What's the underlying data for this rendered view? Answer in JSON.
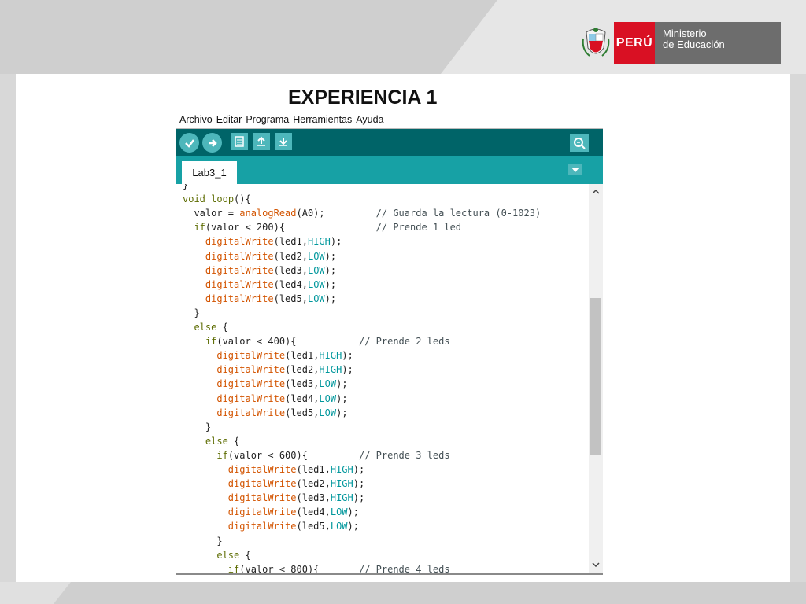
{
  "slide": {
    "title": "EXPERIENCIA 1",
    "brand": {
      "country": "PERÚ",
      "ministry_line1": "Ministerio",
      "ministry_line2": "de Educación"
    }
  },
  "ide": {
    "menu": [
      "Archivo",
      "Editar",
      "Programa",
      "Herramientas",
      "Ayuda"
    ],
    "toolbar": [
      "verify-icon",
      "upload-icon",
      "new-icon",
      "open-icon",
      "save-icon",
      "serial-monitor-icon"
    ],
    "tab_label": "Lab3_1",
    "code_lines": [
      [
        {
          "t": "}",
          "c": ""
        }
      ],
      [
        {
          "t": "void",
          "c": "kw"
        },
        {
          "t": " ",
          "c": ""
        },
        {
          "t": "loop",
          "c": "kw"
        },
        {
          "t": "(){",
          "c": ""
        }
      ],
      [
        {
          "t": "  valor = ",
          "c": ""
        },
        {
          "t": "analogRead",
          "c": "fn"
        },
        {
          "t": "(A0);         ",
          "c": ""
        },
        {
          "t": "// Guarda la lectura (0-1023)",
          "c": "cm"
        }
      ],
      [
        {
          "t": "  ",
          "c": ""
        },
        {
          "t": "if",
          "c": "kw"
        },
        {
          "t": "(valor < 200){                ",
          "c": ""
        },
        {
          "t": "// Prende 1 led",
          "c": "cm"
        }
      ],
      [
        {
          "t": "    ",
          "c": ""
        },
        {
          "t": "digitalWrite",
          "c": "fn"
        },
        {
          "t": "(led1,",
          "c": ""
        },
        {
          "t": "HIGH",
          "c": "cs"
        },
        {
          "t": ");",
          "c": ""
        }
      ],
      [
        {
          "t": "    ",
          "c": ""
        },
        {
          "t": "digitalWrite",
          "c": "fn"
        },
        {
          "t": "(led2,",
          "c": ""
        },
        {
          "t": "LOW",
          "c": "cs"
        },
        {
          "t": ");",
          "c": ""
        }
      ],
      [
        {
          "t": "    ",
          "c": ""
        },
        {
          "t": "digitalWrite",
          "c": "fn"
        },
        {
          "t": "(led3,",
          "c": ""
        },
        {
          "t": "LOW",
          "c": "cs"
        },
        {
          "t": ");",
          "c": ""
        }
      ],
      [
        {
          "t": "    ",
          "c": ""
        },
        {
          "t": "digitalWrite",
          "c": "fn"
        },
        {
          "t": "(led4,",
          "c": ""
        },
        {
          "t": "LOW",
          "c": "cs"
        },
        {
          "t": ");",
          "c": ""
        }
      ],
      [
        {
          "t": "    ",
          "c": ""
        },
        {
          "t": "digitalWrite",
          "c": "fn"
        },
        {
          "t": "(led5,",
          "c": ""
        },
        {
          "t": "LOW",
          "c": "cs"
        },
        {
          "t": ");",
          "c": ""
        }
      ],
      [
        {
          "t": "  }",
          "c": ""
        }
      ],
      [
        {
          "t": "  ",
          "c": ""
        },
        {
          "t": "else",
          "c": "kw"
        },
        {
          "t": " {",
          "c": ""
        }
      ],
      [
        {
          "t": "    ",
          "c": ""
        },
        {
          "t": "if",
          "c": "kw"
        },
        {
          "t": "(valor < 400){           ",
          "c": ""
        },
        {
          "t": "// Prende 2 leds",
          "c": "cm"
        }
      ],
      [
        {
          "t": "      ",
          "c": ""
        },
        {
          "t": "digitalWrite",
          "c": "fn"
        },
        {
          "t": "(led1,",
          "c": ""
        },
        {
          "t": "HIGH",
          "c": "cs"
        },
        {
          "t": ");",
          "c": ""
        }
      ],
      [
        {
          "t": "      ",
          "c": ""
        },
        {
          "t": "digitalWrite",
          "c": "fn"
        },
        {
          "t": "(led2,",
          "c": ""
        },
        {
          "t": "HIGH",
          "c": "cs"
        },
        {
          "t": ");",
          "c": ""
        }
      ],
      [
        {
          "t": "      ",
          "c": ""
        },
        {
          "t": "digitalWrite",
          "c": "fn"
        },
        {
          "t": "(led3,",
          "c": ""
        },
        {
          "t": "LOW",
          "c": "cs"
        },
        {
          "t": ");",
          "c": ""
        }
      ],
      [
        {
          "t": "      ",
          "c": ""
        },
        {
          "t": "digitalWrite",
          "c": "fn"
        },
        {
          "t": "(led4,",
          "c": ""
        },
        {
          "t": "LOW",
          "c": "cs"
        },
        {
          "t": ");",
          "c": ""
        }
      ],
      [
        {
          "t": "      ",
          "c": ""
        },
        {
          "t": "digitalWrite",
          "c": "fn"
        },
        {
          "t": "(led5,",
          "c": ""
        },
        {
          "t": "LOW",
          "c": "cs"
        },
        {
          "t": ");",
          "c": ""
        }
      ],
      [
        {
          "t": "    }",
          "c": ""
        }
      ],
      [
        {
          "t": "    ",
          "c": ""
        },
        {
          "t": "else",
          "c": "kw"
        },
        {
          "t": " {",
          "c": ""
        }
      ],
      [
        {
          "t": "      ",
          "c": ""
        },
        {
          "t": "if",
          "c": "kw"
        },
        {
          "t": "(valor < 600){         ",
          "c": ""
        },
        {
          "t": "// Prende 3 leds",
          "c": "cm"
        }
      ],
      [
        {
          "t": "        ",
          "c": ""
        },
        {
          "t": "digitalWrite",
          "c": "fn"
        },
        {
          "t": "(led1,",
          "c": ""
        },
        {
          "t": "HIGH",
          "c": "cs"
        },
        {
          "t": ");",
          "c": ""
        }
      ],
      [
        {
          "t": "        ",
          "c": ""
        },
        {
          "t": "digitalWrite",
          "c": "fn"
        },
        {
          "t": "(led2,",
          "c": ""
        },
        {
          "t": "HIGH",
          "c": "cs"
        },
        {
          "t": ");",
          "c": ""
        }
      ],
      [
        {
          "t": "        ",
          "c": ""
        },
        {
          "t": "digitalWrite",
          "c": "fn"
        },
        {
          "t": "(led3,",
          "c": ""
        },
        {
          "t": "HIGH",
          "c": "cs"
        },
        {
          "t": ");",
          "c": ""
        }
      ],
      [
        {
          "t": "        ",
          "c": ""
        },
        {
          "t": "digitalWrite",
          "c": "fn"
        },
        {
          "t": "(led4,",
          "c": ""
        },
        {
          "t": "LOW",
          "c": "cs"
        },
        {
          "t": ");",
          "c": ""
        }
      ],
      [
        {
          "t": "        ",
          "c": ""
        },
        {
          "t": "digitalWrite",
          "c": "fn"
        },
        {
          "t": "(led5,",
          "c": ""
        },
        {
          "t": "LOW",
          "c": "cs"
        },
        {
          "t": ");",
          "c": ""
        }
      ],
      [
        {
          "t": "      }",
          "c": ""
        }
      ],
      [
        {
          "t": "      ",
          "c": ""
        },
        {
          "t": "else",
          "c": "kw"
        },
        {
          "t": " {",
          "c": ""
        }
      ],
      [
        {
          "t": "        ",
          "c": ""
        },
        {
          "t": "if",
          "c": "kw"
        },
        {
          "t": "(valor < 800){       ",
          "c": ""
        },
        {
          "t": "// Prende 4 leds",
          "c": "cm"
        }
      ]
    ]
  }
}
